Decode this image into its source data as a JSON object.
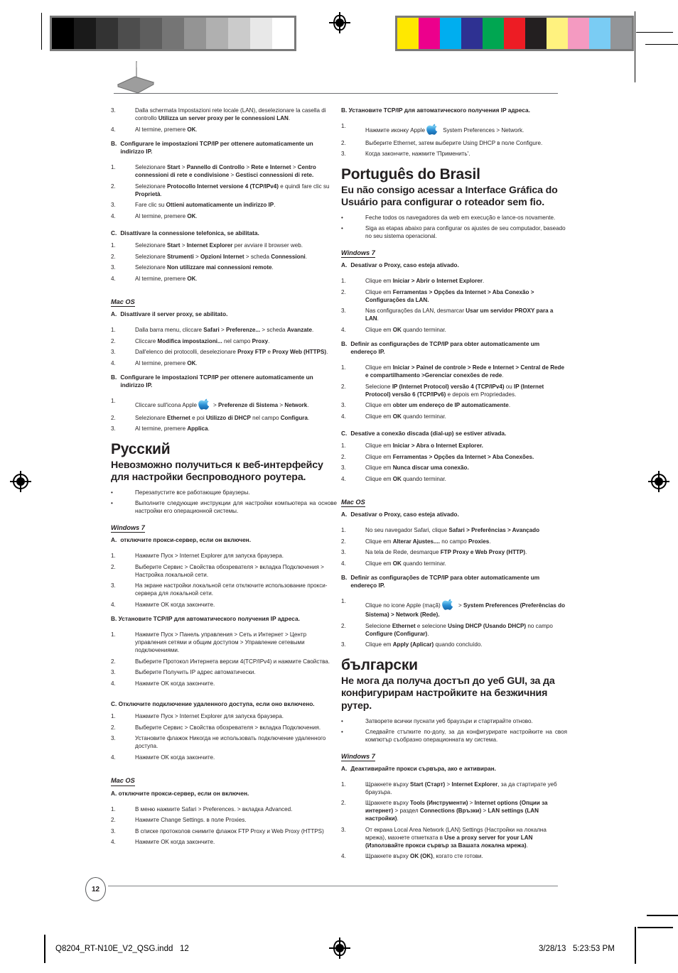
{
  "page": {
    "number": "12",
    "footer_file": "Q8204_RT-N10E_V2_QSG.indd   12",
    "footer_date": "3/28/13   5:23:53 PM"
  },
  "calibration": {
    "gray_steps": [
      "#000000",
      "#1a1a1a",
      "#333333",
      "#4d4d4d",
      "#5e5e5e",
      "#757575",
      "#949494",
      "#b0b0b0",
      "#cbcbcb",
      "#e8e8e8",
      "#ffffff"
    ],
    "color_steps": [
      "#ffe800",
      "#ec008c",
      "#00aeef",
      "#2e3192",
      "#00a651",
      "#ed1c24",
      "#231f20",
      "#fff27f",
      "#f49ac1",
      "#7accf4",
      "#939598"
    ]
  },
  "italian": {
    "cont_steps": [
      {
        "num": "3.",
        "html": "Dalla schermata Impostazioni rete locale (LAN), deselezionare la casella di controllo <b>Utilizza un server proxy per le connessioni LAN</b>."
      },
      {
        "num": "4.",
        "html": "Al termine, premere <b>OK</b>."
      }
    ],
    "sec_b": {
      "label": "B.",
      "text": "Configurare le impostazioni TCP/IP per ottenere automaticamente un indirizzo IP."
    },
    "sec_b_steps": [
      {
        "num": "1.",
        "html": "Selezionare <b>Start</b> > <b>Pannello di Controllo</b> > <b>Rete e Internet</b> > <b>Centro connessioni di rete e condivisione</b> > <b>Gestisci connessioni di rete.</b>"
      },
      {
        "num": "2.",
        "html": "Selezionare <b>Protocollo Internet versione 4 (TCP/IPv4)</b> e quindi fare clic su <b>Proprietà</b>."
      },
      {
        "num": "3.",
        "html": "Fare clic su <b>Ottieni automaticamente un indirizzo IP</b>."
      },
      {
        "num": "4.",
        "html": "Al termine, premere <b>OK</b>."
      }
    ],
    "sec_c": {
      "label": "C.",
      "text": "Disattivare la connessione telefonica, se abilitata."
    },
    "sec_c_steps": [
      {
        "num": "1.",
        "html": "Selezionare <b>Start</b> > <b>Internet Explorer</b> per avviare il browser web."
      },
      {
        "num": "2.",
        "html": "Selezionare <b>Strumenti</b> > <b>Opzioni Internet</b> > scheda <b>Connessioni</b>."
      },
      {
        "num": "3.",
        "html": "Selezionare <b>Non utilizzare mai connessioni remote</b>."
      },
      {
        "num": "4.",
        "html": "Al termine, premere <b>OK</b>."
      }
    ],
    "macos_label": "Mac OS",
    "mac_a": {
      "label": "A.",
      "text": "Disattivare il server proxy, se abilitato."
    },
    "mac_a_steps": [
      {
        "num": "1.",
        "html": "Dalla barra menu, cliccare <b>Safari</b> > <b>Preferenze...</b> > scheda <b>Avanzate</b>."
      },
      {
        "num": "2.",
        "html": "Cliccare <b>Modifica impostazioni...</b> nel campo <b>Proxy</b>."
      },
      {
        "num": "3.",
        "html": "Dall'elenco dei protocolli, deselezionare <b>Proxy FTP</b> e <b>Proxy Web (HTTPS)</b>."
      },
      {
        "num": "4.",
        "html": "Al termine, premere <b>OK</b>."
      }
    ],
    "mac_b": {
      "label": "B.",
      "text": "Configurare le impostazioni TCP/IP per ottenere automaticamente un indirizzo IP."
    },
    "mac_b_step1_pre": "Cliccare sull'icona Apple",
    "mac_b_step1_post": "> <b>Preferenze di Sistema</b> > <b>Network</b>.",
    "mac_b_steps_rest": [
      {
        "num": "2.",
        "html": "Selezionare <b>Ethernet</b> e poi <b>Utilizzo di DHCP</b> nel campo <b>Configura</b>."
      },
      {
        "num": "3.",
        "html": "Al termine, premere <b>Applica</b>."
      }
    ]
  },
  "russian": {
    "title": "Русский",
    "subtitle": "Невозможно получиться к веб-интерфейсу для настройки беспроводного роутера.",
    "bullets": [
      "Перезапустите все работающие браузеры.",
      "Выполните следующие инструкции для настройки компьютера на основе настройки его операционной системы."
    ],
    "windows_label": "Windows 7",
    "sec_a": {
      "label": "A.",
      "text": "отключите прокси-сервер, если он включен."
    },
    "sec_a_steps": [
      {
        "num": "1.",
        "html": "Нажмите Пуск > Internet Explorer для запуска браузера."
      },
      {
        "num": "2.",
        "html": "Выберите Сервис > Свойства обозревателя > вкладка Подключения > Настройка локальной сети."
      },
      {
        "num": "3.",
        "html": "На экране настройки локальной сети отключите использование прокси-сервера для локальной сети."
      },
      {
        "num": "4.",
        "html": "Нажмите OK когда закончите."
      }
    ],
    "sec_b": {
      "text": "B. Установите TCP/IP для автоматического получения IP адреса."
    },
    "sec_b_steps": [
      {
        "num": "1.",
        "html": "Нажмите Пуск > Панель управления > Сеть и Интернет > Центр управления сетями и общим доступом > Управление сетевыми подключениями."
      },
      {
        "num": "2.",
        "html": "Выберите Протокол Интернета версии 4(TCP/IPv4) и нажмите Свойства."
      },
      {
        "num": "3.",
        "html": "Выберите Получить IP адрес автоматически."
      },
      {
        "num": "4.",
        "html": "Нажмите OK когда закончите."
      }
    ],
    "sec_c": {
      "text": "C. Отключите подключение удаленного доступа, если оно включено."
    },
    "sec_c_steps": [
      {
        "num": "1.",
        "html": "Нажмите Пуск > Internet Explorer для запуска браузера."
      },
      {
        "num": "2.",
        "html": "Выберите Сервис > Свойства обозревателя > вкладка Подключения."
      },
      {
        "num": "3.",
        "html": "Установите флажок Никогда не использовать подключение удаленного доступа."
      },
      {
        "num": "4.",
        "html": "Нажмите OK когда закончите."
      }
    ],
    "macos_label": "Mac OS",
    "mac_a": {
      "text": "A. отключите прокси-сервер, если он включен."
    },
    "mac_a_steps": [
      {
        "num": "1.",
        "html": "В меню нажмите Safari > Preferences. > вкладка Advanced."
      },
      {
        "num": "2.",
        "html": "Нажмите Change Settings. в поле Proxies."
      },
      {
        "num": "3.",
        "html": "В списке протоколов снимите флажок FTP Proxy и Web Proxy (HTTPS)"
      },
      {
        "num": "4.",
        "html": "Нажмите OK когда закончите."
      }
    ]
  },
  "russian_cont": {
    "sec_b": {
      "text": "B. Установите TCP/IP для автоматического получения IP адреса."
    },
    "step1_pre": "Нажмите иконку Apple",
    "step1_post": "System Preferences > Network.",
    "steps_rest": [
      {
        "num": "2.",
        "html": "Выберите Ethernet, затем выберите Using DHCP в поле Configure."
      },
      {
        "num": "3.",
        "html": "Когда закончите, нажмите 'Применить'."
      }
    ]
  },
  "portuguese": {
    "title": "Português do Brasil",
    "subtitle": "Eu não consigo acessar a Interface Gráfica do Usuário para configurar o roteador sem fio.",
    "bullets": [
      "Feche todos os navegadores da web em execução e lance-os novamente.",
      "Siga as etapas abaixo para configurar os ajustes de seu computador, baseado no seu sistema operacional."
    ],
    "windows_label": "Windows 7",
    "sec_a": {
      "label": "A.",
      "text": "Desativar o Proxy, caso esteja ativado."
    },
    "sec_a_steps": [
      {
        "num": "1.",
        "html": "Clique em <b>Iniciar > Abrir o Internet Explorer</b>."
      },
      {
        "num": "2.",
        "html": "Clique em  <b>Ferramentas > Opções da Internet  > Aba Conexão > Configurações da LAN.</b>"
      },
      {
        "num": "3.",
        "html": "Nas configurações da LAN, desmarcar <b>Usar um servidor PROXY para a LAN</b>."
      },
      {
        "num": "4.",
        "html": "Clique em <b>OK</b> quando terminar."
      }
    ],
    "sec_b": {
      "label": "B.",
      "text": "Definir as configurações de TCP/IP para obter automaticamente um endereço IP."
    },
    "sec_b_steps": [
      {
        "num": "1.",
        "html": "Clique em <b>Iniciar > Painel de controle > Rede e Internet > Central de Rede e compartilhamento >Gerenciar conexões de rede</b>."
      },
      {
        "num": "2.",
        "html": "Selecione <b>IP (Internet Protocol) versão 4 (TCP/IPv4)</b> ou <b>IP (Internet Protocol) versão 6 (TCP/IPv6)</b> e depois em Propriedades."
      },
      {
        "num": "3.",
        "html": "Clique em <b>obter um endereço de IP automaticamente</b>."
      },
      {
        "num": "4.",
        "html": "Clique em <b>OK</b> quando terminar."
      }
    ],
    "sec_c": {
      "label": "C.",
      "text": "Desative a conexão discada (dial-up) se estiver ativada."
    },
    "sec_c_steps": [
      {
        "num": "1.",
        "html": "Clique em <b>Iniciar > Abra o Internet Explorer.</b>"
      },
      {
        "num": "2.",
        "html": "Clique em <b>Ferramentas > Opções da Internet > Aba Conexões.</b>"
      },
      {
        "num": "3.",
        "html": "Clique em <b>Nunca discar uma conexão.</b>"
      },
      {
        "num": "4.",
        "html": "Clique em <b>OK</b> quando terminar."
      }
    ],
    "macos_label": "Mac OS",
    "mac_a": {
      "label": "A.",
      "text": "Desativar o Proxy, caso esteja ativado."
    },
    "mac_a_steps": [
      {
        "num": "1.",
        "html": "No seu navegador Safari, clique <b>Safari > Preferências > Avançado</b>"
      },
      {
        "num": "2.",
        "html": "Clique em <b>Alterar Ajustes....</b> no campo <b>Proxies</b>."
      },
      {
        "num": "3.",
        "html": "Na tela de Rede, desmarque <b>FTP Proxy e Web Proxy (HTTP)</b>."
      },
      {
        "num": "4.",
        "html": "Clique em <b>OK</b> quando terminar."
      }
    ],
    "mac_b": {
      "label": "B.",
      "text": "Definir as configurações de TCP/IP para obter automaticamente um endereço IP."
    },
    "mac_b_step1_pre": "Clique no icone Apple (maçã)",
    "mac_b_step1_post": "> <b>System Preferences (Preferências do Sistema) > Network (Rede).</b>",
    "mac_b_steps_rest": [
      {
        "num": "2.",
        "html": "Selecione <b>Ethernet</b> e selecione <b>Using DHCP (Usando DHCP)</b> no campo <b>Configure (Configurar)</b>."
      },
      {
        "num": "3.",
        "html": "Clique em <b>Apply (Aplicar)</b> quando concluído."
      }
    ]
  },
  "bulgarian": {
    "title": "български",
    "subtitle": "Не мога да получа достъп до уеб GUI, за да конфигурирам настройките на безжичния рутер.",
    "bullets": [
      "Затворете всички пуснати уеб браузъри и стартирайте отново.",
      "Следвайте стъпките по-долу, за да конфигурирате настройките на своя компютър съобразно операционната му система."
    ],
    "windows_label": "Windows 7",
    "sec_a": {
      "label": "A.",
      "text": "Деактивирайте прокси сървъра, ако е активиран."
    },
    "sec_a_steps": [
      {
        "num": "1.",
        "html": "Щракнете върху <b>Start (Старт)</b> > <b>Internet Explorer</b>, за да стартирате уеб браузъра."
      },
      {
        "num": "2.",
        "html": "Щракнете върху <b>Tools (Инструменти)</b> > <b>Internet options (Опции за интернет)</b> > раздел <b>Connections (Връзки)</b> > <b>LAN settings (LAN настройки)</b>."
      },
      {
        "num": "3.",
        "html": "От екрана Local Area Network (LAN) Settings (Настройки на локална мрежа), махнете отметката в <b>Use a proxy server for your LAN (Използвайте прокси сървър за Вашата локална мрежа)</b>."
      },
      {
        "num": "4.",
        "html": "Щракнете върху <b>OK (OK)</b>, когато сте готови."
      }
    ]
  }
}
